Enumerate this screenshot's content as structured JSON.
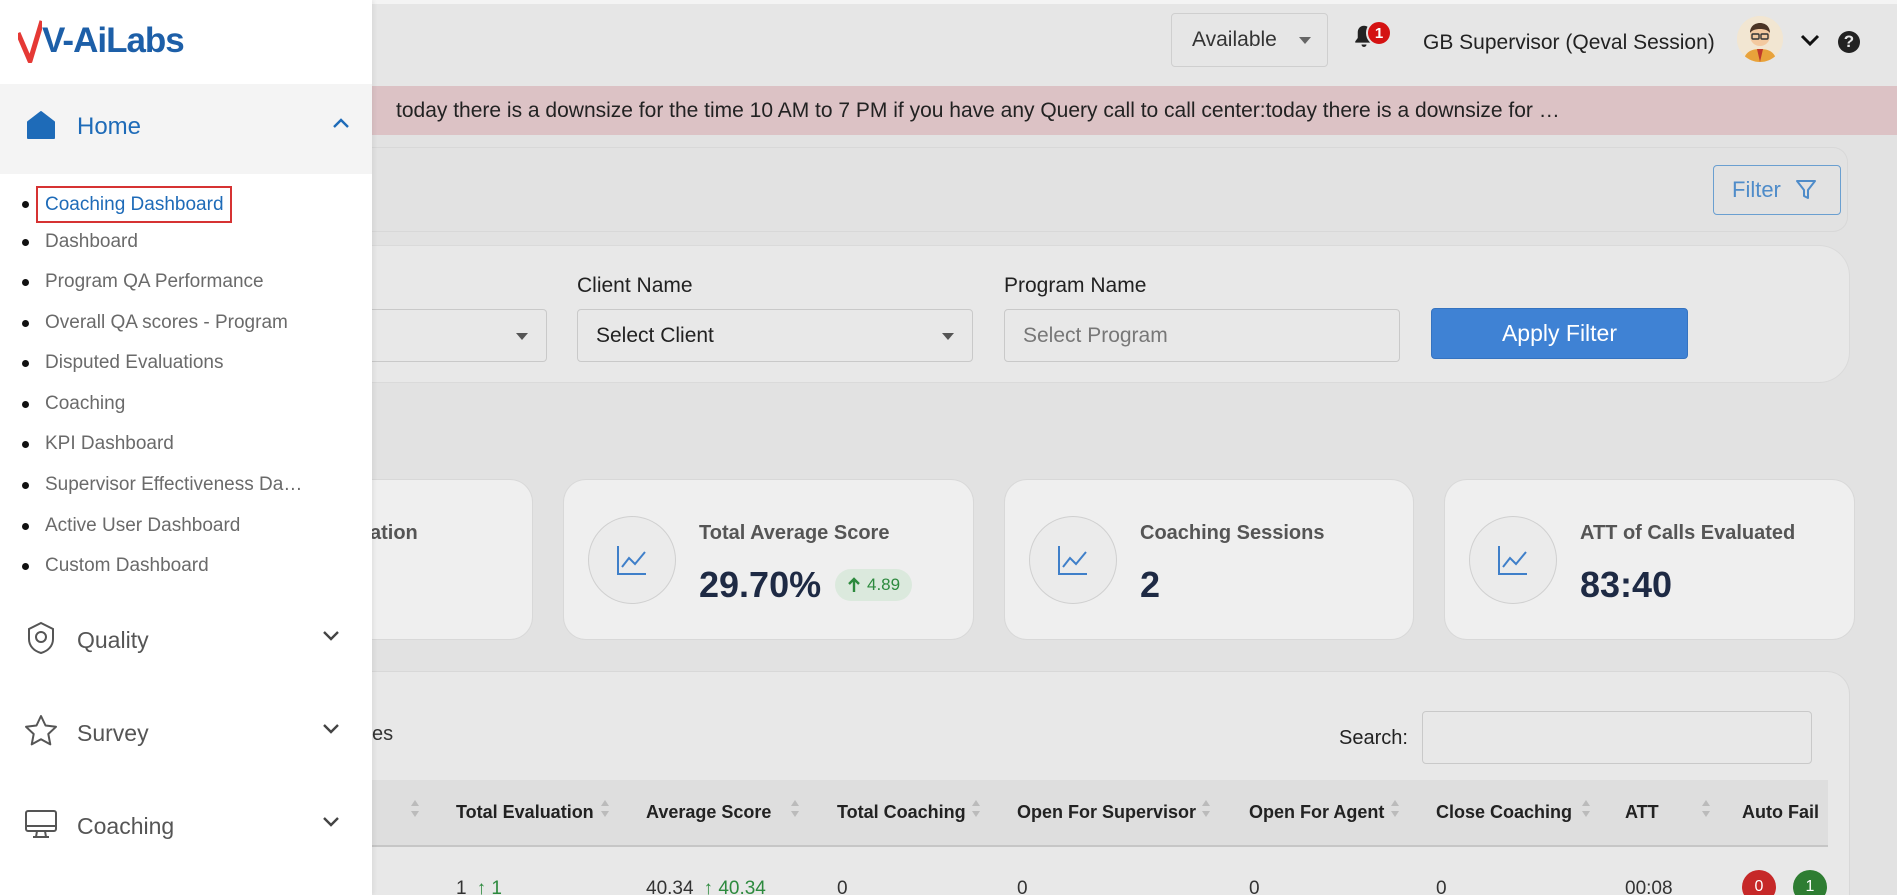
{
  "header": {
    "status_value": "Available",
    "notification_count": "1",
    "user_name": "GB Supervisor (Qeval Session)"
  },
  "announcement": "today there is a downsize for the time 10 AM to 7 PM if you have any Query call to call center:today there is a downsize for …",
  "filter": {
    "button_label": "Filter",
    "client_label": "Client Name",
    "client_value": "Select Client",
    "program_label": "Program Name",
    "program_placeholder": "Select Program",
    "apply_label": "Apply Filter"
  },
  "stats": [
    {
      "title_fragment": "ation"
    },
    {
      "title": "Total Average Score",
      "value": "29.70%",
      "delta": "4.89"
    },
    {
      "title": "Coaching Sessions",
      "value": "2"
    },
    {
      "title": "ATT of Calls Evaluated",
      "value": "83:40"
    }
  ],
  "table": {
    "entries_fragment": "es",
    "search_label": "Search:",
    "columns": [
      "Total Evaluation",
      "Average Score",
      "Total Coaching",
      "Open For Supervisor",
      "Open For Agent",
      "Close Coaching",
      "ATT",
      "Auto Fail"
    ],
    "row": {
      "total_evaluation": "1",
      "total_evaluation_delta": "1",
      "average_score": "40.34",
      "average_score_delta": "40.34",
      "total_coaching": "0",
      "open_for_supervisor": "0",
      "open_for_agent": "0",
      "close_coaching": "0",
      "att": "00:08",
      "auto_fail_red": "0",
      "auto_fail_green": "1"
    }
  },
  "sidebar": {
    "logo_text": "V-AiLabs",
    "home_label": "Home",
    "home_items": [
      "Coaching Dashboard",
      "Dashboard",
      "Program QA Performance",
      "Overall QA scores - Program",
      "Disputed Evaluations",
      "Coaching",
      "KPI Dashboard",
      "Supervisor Effectiveness Da…",
      "Active User Dashboard",
      "Custom Dashboard"
    ],
    "groups": [
      "Quality",
      "Survey",
      "Coaching"
    ]
  },
  "colors": {
    "accent": "#1e6bb8",
    "apply_button": "#3f82d4",
    "announcement_bg": "#dcc2c5",
    "badge_red": "#d41212",
    "positive_green": "#2d8a3e",
    "active_outline": "#d63232"
  },
  "icons": {
    "notification": "bell-icon",
    "help": "question-icon",
    "filter": "funnel-icon",
    "stat": "line-chart-icon",
    "home": "home-icon",
    "quality": "badge-gear-icon",
    "survey": "star-icon",
    "coaching": "monitor-icon"
  }
}
